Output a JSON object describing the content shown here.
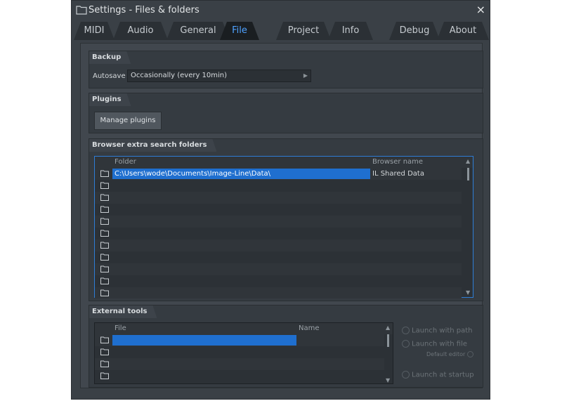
{
  "window": {
    "title": "Settings - Files & folders",
    "close_symbol": "×"
  },
  "tabs": [
    {
      "label": "MIDI",
      "active": false
    },
    {
      "label": "Audio",
      "active": false
    },
    {
      "label": "General",
      "active": false
    },
    {
      "label": "File",
      "active": true
    },
    {
      "label": "Project",
      "active": false
    },
    {
      "label": "Info",
      "active": false
    },
    {
      "label": "Debug",
      "active": false
    },
    {
      "label": "About",
      "active": false
    }
  ],
  "backup": {
    "label": "Backup",
    "autosave_label": "Autosave",
    "autosave_value": "Occasionally (every 10min)"
  },
  "plugins": {
    "label": "Plugins",
    "manage_button": "Manage plugins"
  },
  "browser_folders": {
    "label": "Browser extra search folders",
    "col_folder": "Folder",
    "col_name": "Browser name",
    "rows": [
      {
        "folder": "C:\\Users\\wode\\Documents\\Image-Line\\Data\\",
        "name": "IL Shared Data"
      }
    ]
  },
  "external_tools": {
    "label": "External tools",
    "col_file": "File",
    "col_name": "Name",
    "launch_with_path": "Launch with path",
    "launch_with_file": "Launch with file",
    "default_editor": "Default editor",
    "launch_at_startup": "Launch at startup"
  },
  "colors": {
    "accent": "#4fa2ff",
    "selection": "#1f6fcf",
    "panel": "#41474e"
  },
  "icons": {
    "title": "folder-icon",
    "rows": "folder-icon"
  }
}
